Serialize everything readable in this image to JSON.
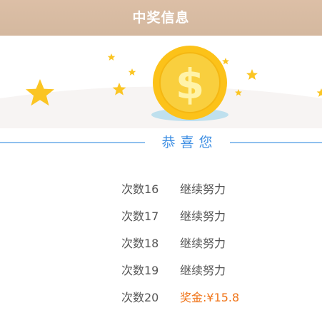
{
  "header": {
    "title": "中奖信息"
  },
  "banner": {
    "coin_symbol": "$",
    "colors": {
      "coin": "#fcc219",
      "coin_inner": "#f9cc3a",
      "star": "#fbc523",
      "shadow": "#bfe0ee"
    }
  },
  "divider": {
    "label": "恭喜您",
    "color": "#3f8fe3",
    "line_color": "#8fc0ee"
  },
  "results": [
    {
      "count": "次数16",
      "status": "继续努力",
      "is_prize": false
    },
    {
      "count": "次数17",
      "status": "继续努力",
      "is_prize": false
    },
    {
      "count": "次数18",
      "status": "继续努力",
      "is_prize": false
    },
    {
      "count": "次数19",
      "status": "继续努力",
      "is_prize": false
    },
    {
      "count": "次数20",
      "status": "奖金:¥15.8",
      "is_prize": true
    }
  ],
  "colors": {
    "header_bg": "#d8bba2",
    "prize_text": "#f07316",
    "normal_text": "#555555"
  }
}
